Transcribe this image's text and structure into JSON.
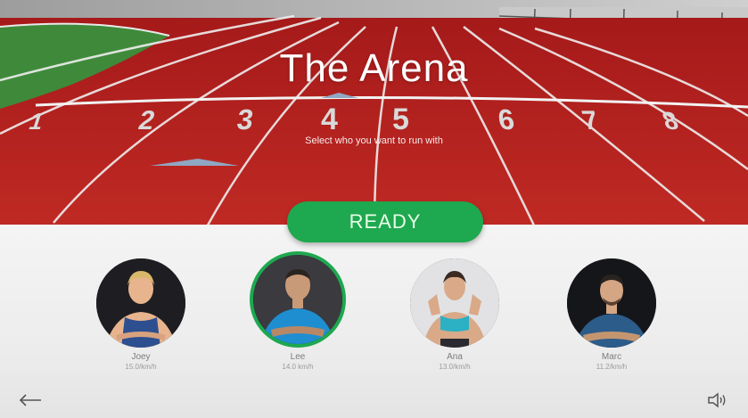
{
  "title": "The Arena",
  "subtitle": "Select who you want to run with",
  "lane_numbers": [
    "1",
    "2",
    "3",
    "4",
    "5",
    "6",
    "7",
    "8"
  ],
  "ready_label": "READY",
  "runners": [
    {
      "name": "Joey",
      "time": "15.0/km/h",
      "selected": false,
      "avatar_bg": "#1e1e22",
      "shirt": "#2d4f8f",
      "skin": "#e8b48e",
      "hair": "#d9b86a"
    },
    {
      "name": "Lee",
      "time": "14.0 km/h",
      "selected": true,
      "avatar_bg": "#3a3a3f",
      "shirt": "#1f8ed0",
      "skin": "#c99a78",
      "hair": "#2a2420"
    },
    {
      "name": "Ana",
      "time": "13.0/km/h",
      "selected": false,
      "avatar_bg": "#e2e2e4",
      "shirt": "#2bb0c4",
      "skin": "#d9a988",
      "hair": "#3a2a22"
    },
    {
      "name": "Marc",
      "time": "11.2/km/h",
      "selected": false,
      "avatar_bg": "#15161a",
      "shirt": "#2c5c8a",
      "skin": "#d4a684",
      "hair": "#2a2420"
    }
  ],
  "colors": {
    "accent": "#1ea84f",
    "track": "#b3201f",
    "infield": "#3f8a3a"
  },
  "icons": {
    "back": "arrow-left-icon",
    "sound": "speaker-icon"
  }
}
